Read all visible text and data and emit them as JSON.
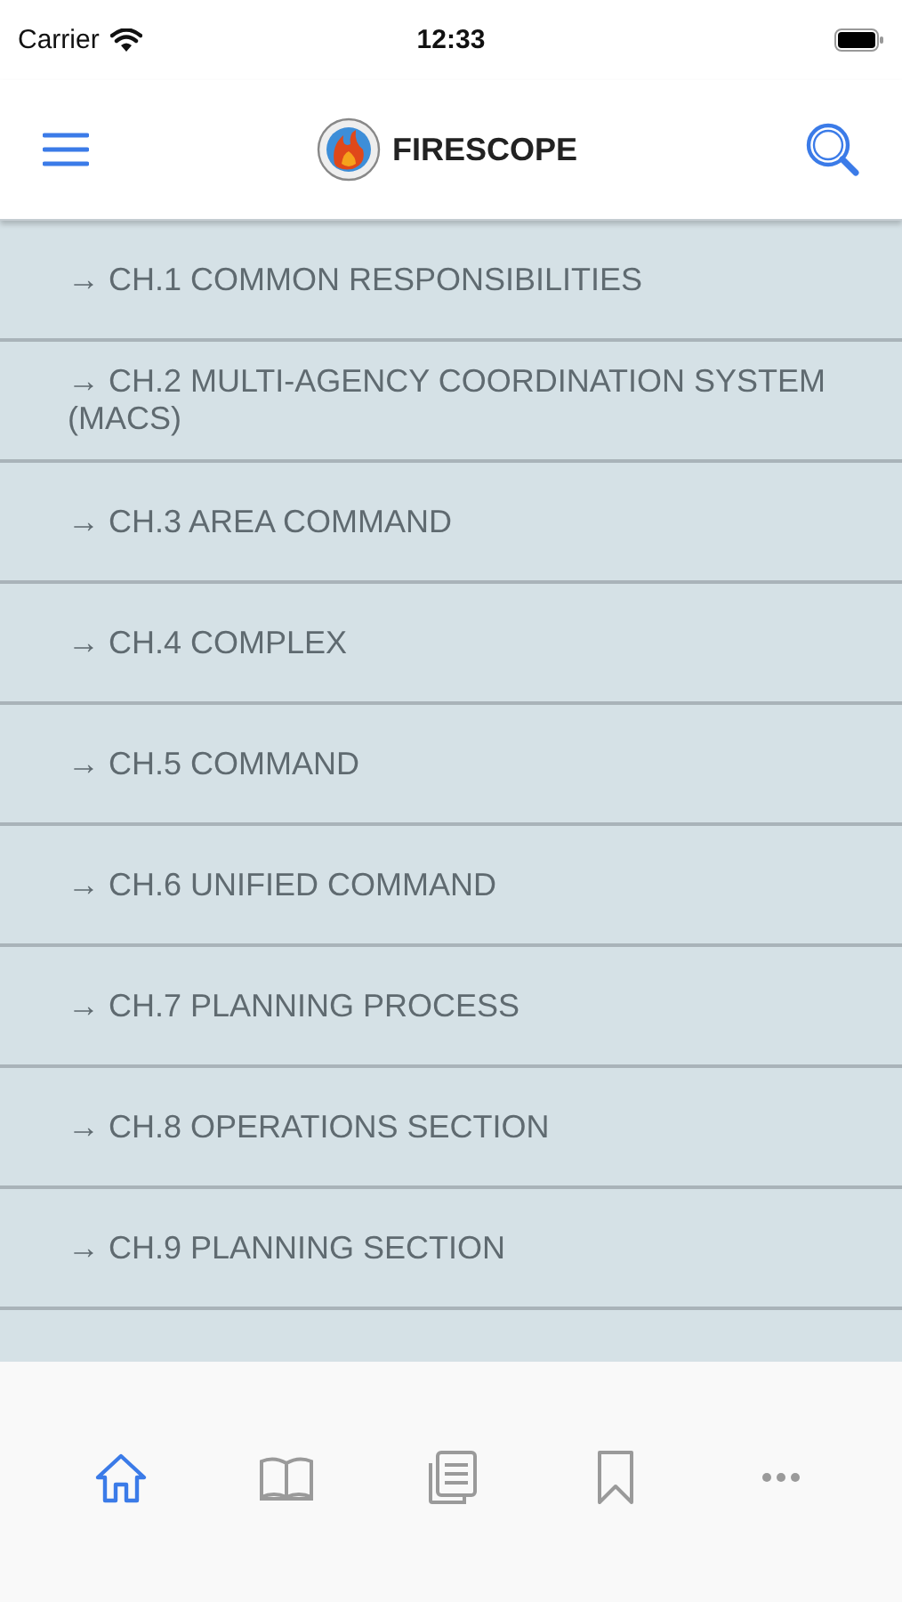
{
  "status_bar": {
    "carrier": "Carrier",
    "time": "12:33"
  },
  "header": {
    "title": "FIRESCOPE"
  },
  "chapters": [
    {
      "label": "→ CH.1 COMMON RESPONSIBILITIES"
    },
    {
      "label": "→ CH.2 MULTI-AGENCY COORDINATION SYSTEM (MACS)"
    },
    {
      "label": "→ CH.3 AREA COMMAND"
    },
    {
      "label": "→ CH.4 COMPLEX"
    },
    {
      "label": "→ CH.5 COMMAND"
    },
    {
      "label": "→ CH.6 UNIFIED COMMAND"
    },
    {
      "label": "→ CH.7 PLANNING PROCESS"
    },
    {
      "label": "→ CH.8 OPERATIONS SECTION"
    },
    {
      "label": "→ CH.9 PLANNING SECTION"
    }
  ],
  "tab_bar": [
    {
      "kind": "home",
      "selected": true
    },
    {
      "kind": "book",
      "selected": false
    },
    {
      "kind": "pages",
      "selected": false
    },
    {
      "kind": "bookmark",
      "selected": false
    },
    {
      "kind": "more",
      "selected": false
    }
  ]
}
